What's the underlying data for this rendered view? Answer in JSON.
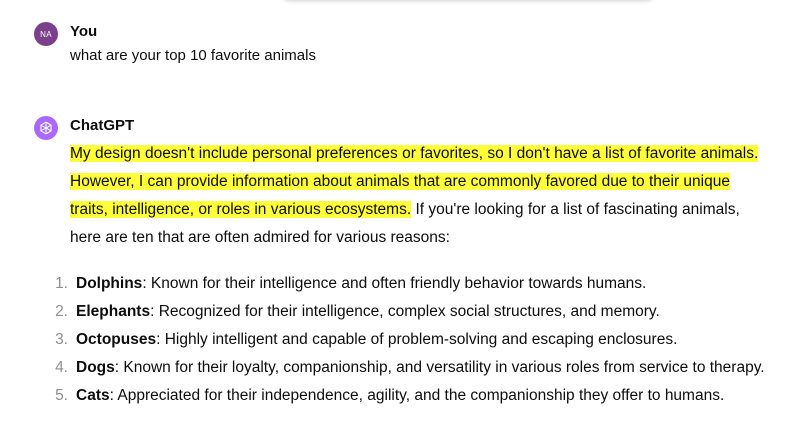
{
  "user_turn": {
    "initials": "NA",
    "author": "You",
    "message": "what are your top 10 favorite animals"
  },
  "assistant_turn": {
    "author": "ChatGPT",
    "intro_highlighted": "My design doesn't include personal preferences or favorites, so I don't have a list of favorite animals. However, I can provide information about animals that are commonly favored due to their unique traits, intelligence, or roles in various ecosystems.",
    "intro_rest": " If you're looking for a list of fascinating animals, here are ten that are often admired for various reasons:",
    "list": [
      {
        "num": "1.",
        "name": "Dolphins",
        "desc": ": Known for their intelligence and often friendly behavior towards humans."
      },
      {
        "num": "2.",
        "name": "Elephants",
        "desc": ": Recognized for their intelligence, complex social structures, and memory."
      },
      {
        "num": "3.",
        "name": "Octopuses",
        "desc": ": Highly intelligent and capable of problem-solving and escaping enclosures."
      },
      {
        "num": "4.",
        "name": "Dogs",
        "desc": ": Known for their loyalty, companionship, and versatility in various roles from service to therapy."
      },
      {
        "num": "5.",
        "name": "Cats",
        "desc": ": Appreciated for their independence, agility, and the companionship they offer to humans."
      }
    ]
  },
  "colors": {
    "highlight": "#ffff3a",
    "user_avatar": "#7b3f8c",
    "gpt_avatar": "#ab68ff",
    "list_number": "#8e8e8e"
  },
  "icons": {
    "gpt_avatar": "openai-logo-icon"
  }
}
